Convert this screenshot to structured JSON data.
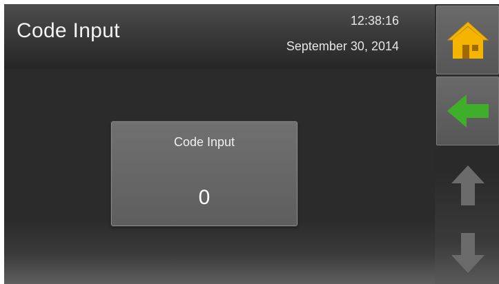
{
  "header": {
    "title": "Code Input",
    "time": "12:38:16",
    "date": "September 30, 2014"
  },
  "code_card": {
    "label": "Code Input",
    "value": "0"
  },
  "sidebar": {
    "home_icon": "home-icon",
    "back_icon": "back-arrow-icon",
    "up_icon": "up-arrow-icon",
    "down_icon": "down-arrow-icon"
  },
  "colors": {
    "home_house": "#f5b400",
    "back_arrow": "#3fae2a",
    "scroll_arrow": "#6b6b6b"
  }
}
